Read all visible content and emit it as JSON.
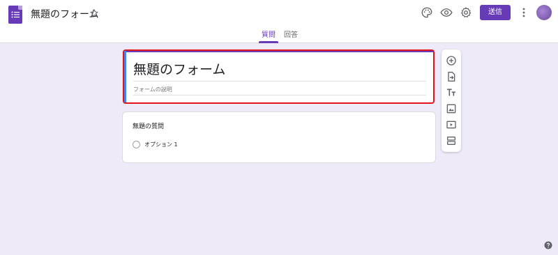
{
  "header": {
    "title": "無題のフォーム",
    "send_label": "送信",
    "icons": [
      "palette-icon",
      "preview-eye-icon",
      "settings-gear-icon",
      "more-vert-icon",
      "star-icon"
    ]
  },
  "tabs": [
    {
      "label": "質問",
      "active": true
    },
    {
      "label": "回答",
      "active": false
    }
  ],
  "form": {
    "title": "無題のフォーム",
    "description_placeholder": "フォームの説明"
  },
  "question": {
    "title": "無題の質問",
    "options": [
      "オプション 1"
    ]
  },
  "toolbar": {
    "tools": [
      "add-question-icon",
      "import-questions-icon",
      "add-title-icon",
      "add-image-icon",
      "add-video-icon",
      "add-section-icon"
    ]
  },
  "colors": {
    "accent": "#673ab7",
    "background": "#efeaf8",
    "highlight_border": "#e0141a"
  }
}
